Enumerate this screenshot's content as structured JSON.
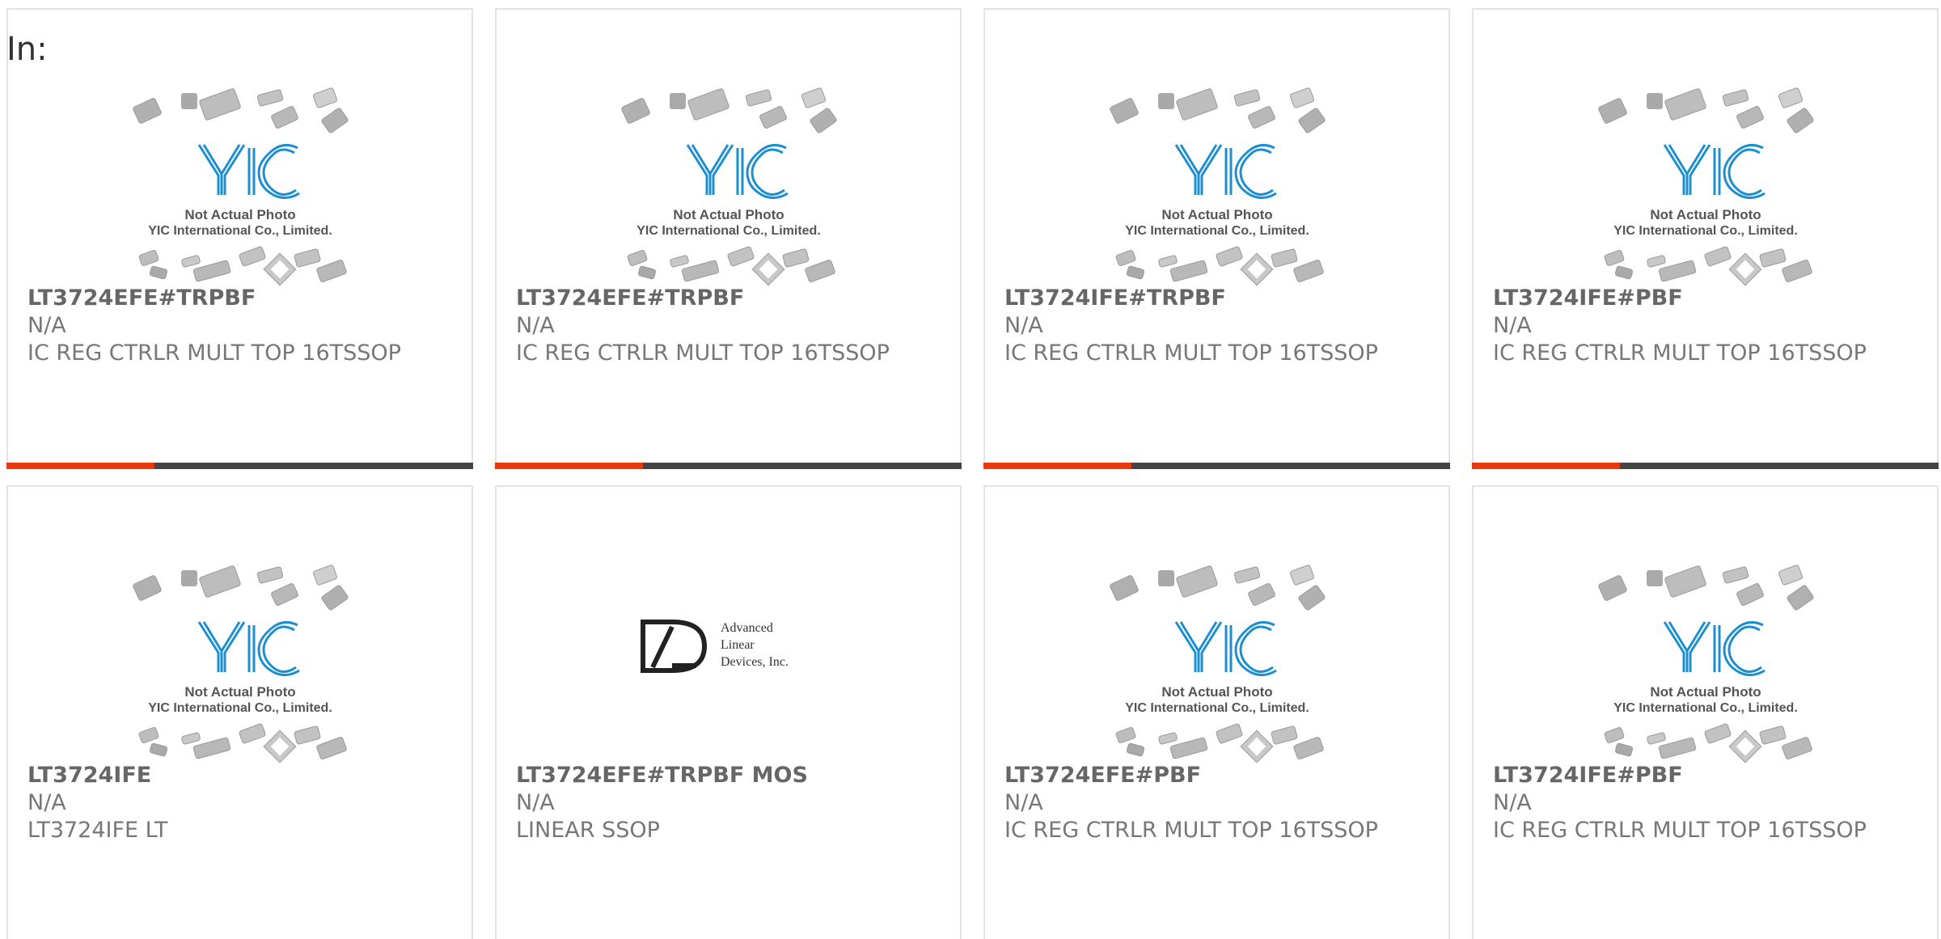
{
  "header": {
    "label": "In:"
  },
  "colors": {
    "accent": "#e8380d",
    "bar": "#444444",
    "logo_blue": "#1d8fd1"
  },
  "placeholder_image": {
    "icon": "yic-placeholder-image",
    "line1": "Not Actual Photo",
    "line2": "YIC International Co., Limited."
  },
  "brand_logo": {
    "icon": "advanced-linear-devices-logo",
    "line1": "Advanced",
    "line2": "Linear",
    "line3": "Devices, Inc."
  },
  "products": [
    {
      "part": "LT3724EFE#TRPBF",
      "mfr": "N/A",
      "desc": "IC REG CTRLR MULT TOP 16TSSOP",
      "image": "yic"
    },
    {
      "part": "LT3724EFE#TRPBF",
      "mfr": "N/A",
      "desc": "IC REG CTRLR MULT TOP 16TSSOP",
      "image": "yic"
    },
    {
      "part": "LT3724IFE#TRPBF",
      "mfr": "N/A",
      "desc": "IC REG CTRLR MULT TOP 16TSSOP",
      "image": "yic"
    },
    {
      "part": "LT3724IFE#PBF",
      "mfr": "N/A",
      "desc": "IC REG CTRLR MULT TOP 16TSSOP",
      "image": "yic"
    },
    {
      "part": "LT3724IFE",
      "mfr": "N/A",
      "desc": "LT3724IFE LT",
      "image": "yic"
    },
    {
      "part": "LT3724EFE#TRPBF MOS",
      "mfr": "N/A",
      "desc": "LINEAR SSOP",
      "image": "ald"
    },
    {
      "part": "LT3724EFE#PBF",
      "mfr": "N/A",
      "desc": "IC REG CTRLR MULT TOP 16TSSOP",
      "image": "yic"
    },
    {
      "part": "LT3724IFE#PBF",
      "mfr": "N/A",
      "desc": "IC REG CTRLR MULT TOP 16TSSOP",
      "image": "yic"
    }
  ]
}
